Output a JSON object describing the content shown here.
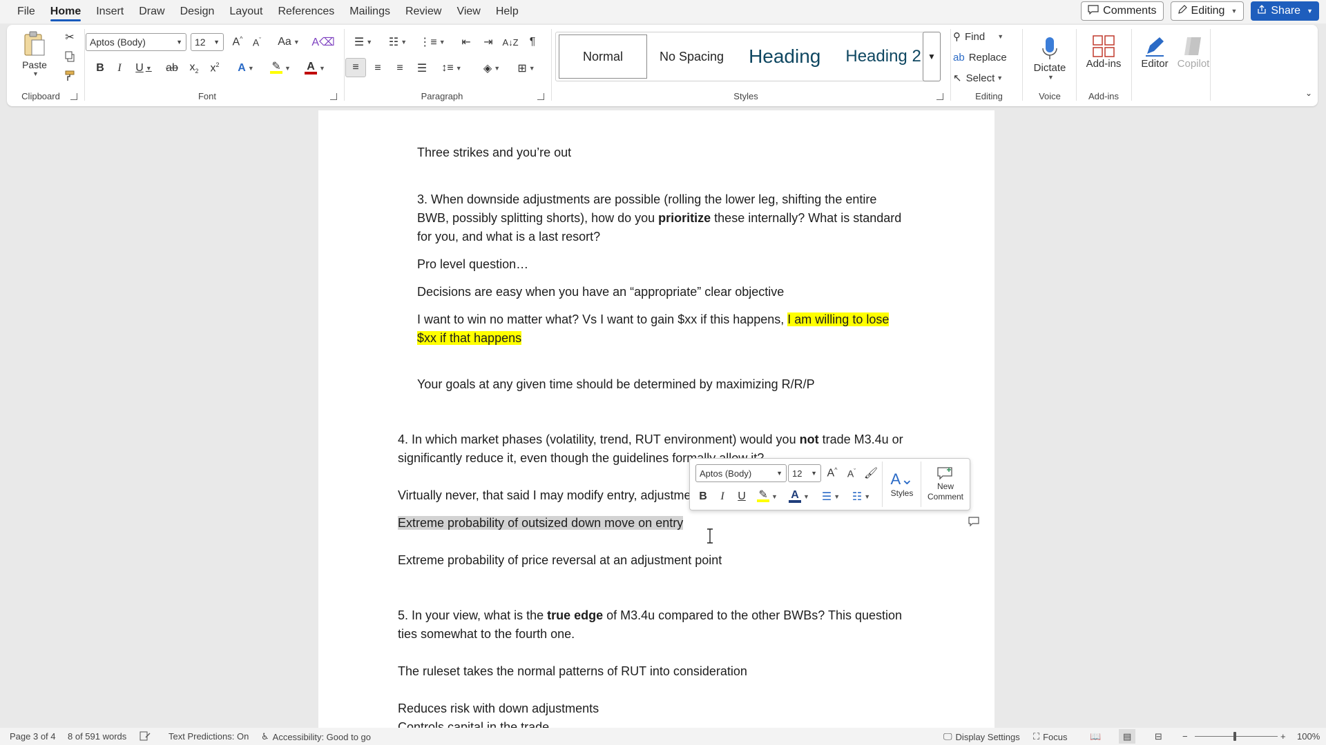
{
  "menubar": {
    "items": [
      "File",
      "Home",
      "Insert",
      "Draw",
      "Design",
      "Layout",
      "References",
      "Mailings",
      "Review",
      "View",
      "Help"
    ],
    "active": "Home",
    "comments_label": "Comments",
    "editing_label": "Editing",
    "share_label": "Share"
  },
  "ribbon": {
    "clipboard": {
      "paste_label": "Paste",
      "group_label": "Clipboard"
    },
    "font": {
      "font_name": "Aptos (Body)",
      "font_size": "12",
      "group_label": "Font"
    },
    "paragraph": {
      "group_label": "Paragraph"
    },
    "styles": {
      "items": [
        "Normal",
        "No Spacing",
        "Heading 1",
        "Heading 2"
      ],
      "heading1_display": "Heading",
      "group_label": "Styles"
    },
    "editing": {
      "find_label": "Find",
      "replace_label": "Replace",
      "select_label": "Select",
      "group_label": "Editing"
    },
    "voice": {
      "dictate_label": "Dictate",
      "group_label": "Voice"
    },
    "addins": {
      "addins_label": "Add-ins",
      "group_label": "Add-ins"
    },
    "editor_label": "Editor",
    "copilot_label": "Copilot"
  },
  "document": {
    "p1": "Three strikes and you’re out",
    "p2a": "3. When downside adjustments are possible (rolling the lower leg, shifting the entire",
    "p2b_pre": "BWB, possibly splitting shorts), how do you ",
    "p2b_bold": "prioritize",
    "p2b_post": " these internally? What is standard",
    "p2c": "for you, and what is a last resort?",
    "p3": "Pro level question…",
    "p4": "Decisions are easy when you have an “appropriate” clear objective",
    "p5a_pre": "I want to win no matter what? Vs I want to gain $xx if this happens, ",
    "p5a_hl": "I am willing to lose",
    "p5b_hl": "$xx if that happens",
    "p6": "Your goals at any given time should be determined by maximizing R/R/P",
    "p7a_pre": "4. In which market phases (volatility, trend, RUT environment) would you ",
    "p7a_bold": "not",
    "p7a_post": " trade M3.4u or",
    "p7b": "significantly reduce it, even though the guidelines formally allow it?",
    "p8": "Virtually never, that said I may modify entry, adjustments, ...",
    "p9": "Extreme probability of outsized down move on entry",
    "p10": "Extreme probability of price reversal at an adjustment point",
    "p11a_pre": "5. In your view, what is the ",
    "p11a_bold": "true edge",
    "p11a_post": " of M3.4u compared to the other BWBs? This question",
    "p11b": "ties somewhat to the fourth one.",
    "p12": "The ruleset takes the normal patterns of RUT into consideration",
    "p13": "Reduces risk with down adjustments",
    "p14": "Controls capital in the trade"
  },
  "minitoolbar": {
    "font_name": "Aptos (Body)",
    "font_size": "12",
    "styles_label": "Styles",
    "new_comment_label_1": "New",
    "new_comment_label_2": "Comment"
  },
  "statusbar": {
    "page": "Page 3 of 4",
    "words": "8 of 591 words",
    "text_predictions": "Text Predictions: On",
    "accessibility": "Accessibility: Good to go",
    "display_settings": "Display Settings",
    "focus": "Focus",
    "zoom": "100%"
  },
  "colors": {
    "accent": "#185abd",
    "share_bg": "#1e5ebd",
    "highlight": "#ffff00",
    "selection": "#d3d3d3"
  }
}
